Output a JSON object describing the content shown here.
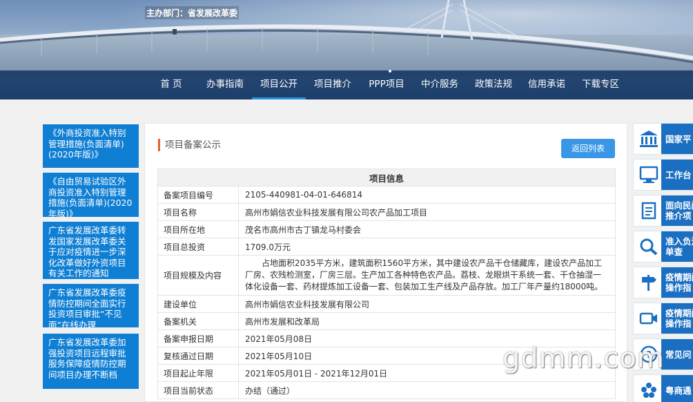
{
  "header": {
    "sponsor": "主办部门：省发展改革委"
  },
  "nav": {
    "items": [
      {
        "label": "首 页",
        "active": false
      },
      {
        "label": "办事指南",
        "active": false
      },
      {
        "label": "项目公开",
        "active": true
      },
      {
        "label": "项目推介",
        "active": false
      },
      {
        "label": "PPP项目",
        "active": false
      },
      {
        "label": "中介服务",
        "active": false
      },
      {
        "label": "政策法规",
        "active": false
      },
      {
        "label": "信用承诺",
        "active": false
      },
      {
        "label": "下载专区",
        "active": false
      }
    ]
  },
  "left_sidebar": {
    "links": [
      "《外商投资准入特别管理措施(负面清单)(2020年版)》",
      "《自由贸易试验区外商投资准入特别管理措施(负面清单)(2020年版)》",
      "广东省发展改革委转发国家发展改革委关于应对疫情进一步深化改革做好外资项目有关工作的通知",
      "广东省发展改革委疫情防控期间全面实行投资项目审批“不见面”在线办理",
      "广东省发展改革委加强投资项目远程审批服务保障疫情防控期间项目办理不断档"
    ]
  },
  "main": {
    "panel_title": "项目备案公示",
    "back_button": "返回列表",
    "table_header": "项目信息",
    "rows": [
      {
        "label": "备案项目编号",
        "value": "2105-440981-04-01-646814"
      },
      {
        "label": "项目名称",
        "value": "高州市娟信农业科技发展有限公司农产品加工项目"
      },
      {
        "label": "项目所在地",
        "value": "茂名市高州市古丁镇龙马村委会"
      },
      {
        "label": "项目总投资",
        "value": "1709.0万元"
      },
      {
        "label": "项目规模及内容",
        "value": "占地面积2035平方米，建筑面积1560平方米，其中建设农产品干仓储藏库，建设农产品加工厂房、农残检测室，厂房三层。生产加工各种特色农产品。荔枝、龙眼烘干系统一套、干仓抽湿一体化设备一套、药材提炼加工设备一套、包装加工生产线及产品存放。加工厂年产量约18000吨。"
      },
      {
        "label": "建设单位",
        "value": "高州市娟信农业科技发展有限公司"
      },
      {
        "label": "备案机关",
        "value": "高州市发展和改革局"
      },
      {
        "label": "备案申报日期",
        "value": "2021年05月08日"
      },
      {
        "label": "复核通过日期",
        "value": "2021年05月10日"
      },
      {
        "label": "项目起止年限",
        "value": "2021年05月01日 - 2021年12月01日"
      },
      {
        "label": "项目当前状态",
        "value": "办结（通过）"
      }
    ]
  },
  "right_sidebar": {
    "items": [
      {
        "label": "国家平",
        "icon": "building-icon"
      },
      {
        "label": "工作台",
        "icon": "monitor-icon"
      },
      {
        "label": "面向民间推介项",
        "icon": "document-icon"
      },
      {
        "label": "准入负清单查",
        "icon": "search-icon"
      },
      {
        "label": "疫情期间操作指",
        "icon": "signpost-icon"
      },
      {
        "label": "疫情期间操作指",
        "icon": "video-icon"
      },
      {
        "label": "常见问",
        "icon": "question-icon"
      },
      {
        "label": "粤商通",
        "icon": "flower-icon"
      }
    ]
  },
  "watermark": "gdmm.com",
  "colors": {
    "nav_bg": "#123462",
    "accent_blue": "#0f7fd4",
    "button_blue": "#3a97e8",
    "title_marker": "#e8612c"
  }
}
